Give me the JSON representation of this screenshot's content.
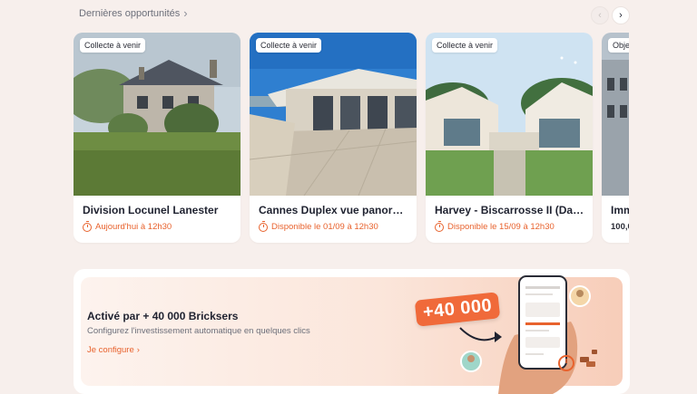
{
  "section": {
    "title": "Dernières opportunités",
    "title_chevron": "›",
    "prev_glyph": "‹",
    "next_glyph": "›"
  },
  "cards": [
    {
      "badge": "Collecte à venir",
      "title": "Division Locunel Lanester",
      "status": "Aujourd'hui à 12h30"
    },
    {
      "badge": "Collecte à venir",
      "title": "Cannes Duplex vue panoramiq...",
      "status": "Disponible le 01/09 à 12h30"
    },
    {
      "badge": "Collecte à venir",
      "title": "Harvey - Biscarrosse II (David ...",
      "status": "Disponible le 15/09 à 12h30"
    },
    {
      "badge": "Obje",
      "title": "Imm",
      "status": "100,0"
    }
  ],
  "promo": {
    "title": "Activé par + 40 000 Bricksers",
    "subtitle": "Configurez l'investissement automatique en quelques clics",
    "link_label": "Je configure",
    "link_chevron": "›",
    "counter": "+40 000"
  },
  "colors": {
    "accent": "#e8622d",
    "background": "#f7efec",
    "card": "#ffffff"
  },
  "icons": [
    "chevron-right-icon",
    "chevron-left-icon",
    "clock-icon",
    "phone-illustration",
    "avatar-icon"
  ]
}
